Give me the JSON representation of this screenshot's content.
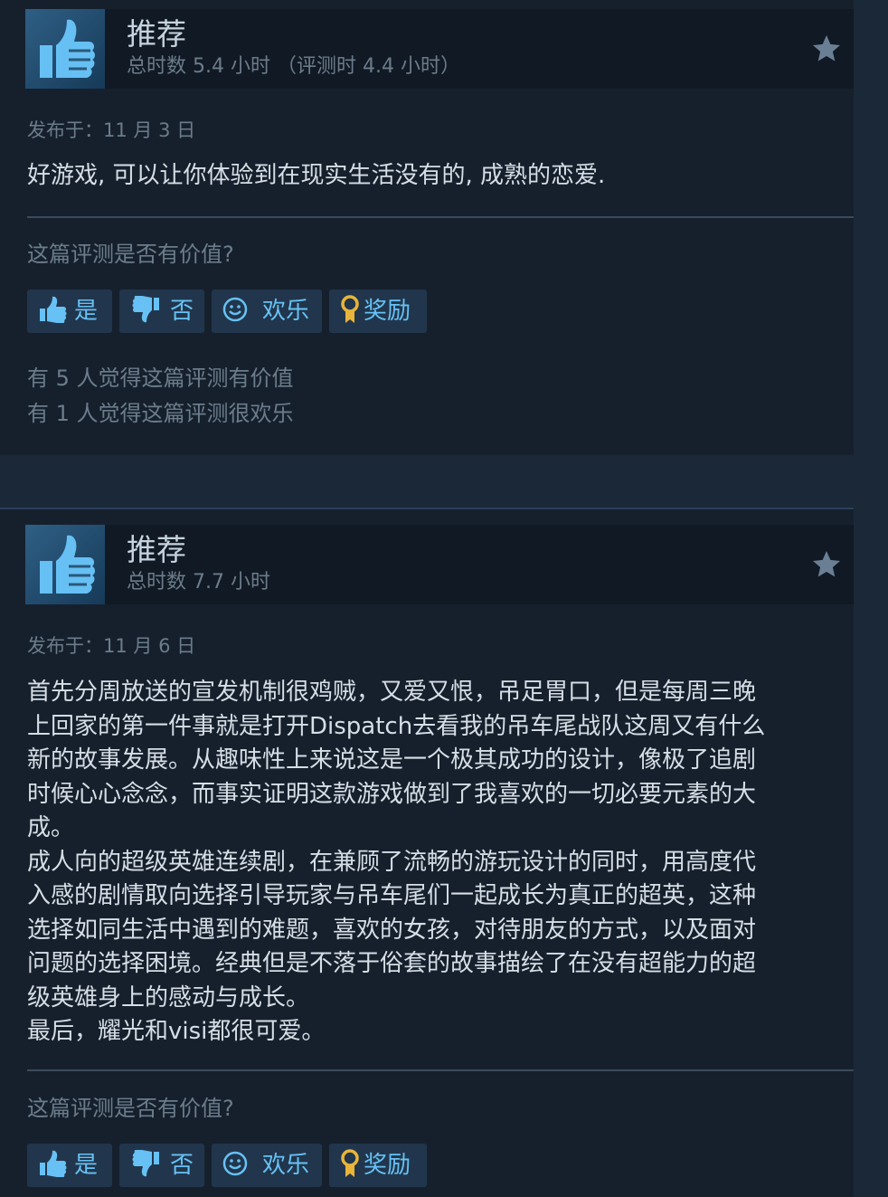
{
  "reviews": [
    {
      "recommendation": "推荐",
      "hours": "总时数 5.4 小时 （评测时 4.4 小时）",
      "posted": "发布于：11 月 3 日",
      "body": [
        "好游戏, 可以让你体验到在现实生活没有的, 成熟的恋爱."
      ],
      "helpful_question": "这篇评测是否有价值?",
      "buttons": {
        "yes": "是",
        "no": "否",
        "funny": "欢乐",
        "award": "奖励"
      },
      "stats": [
        "有 5 人觉得这篇评测有价值",
        "有 1 人觉得这篇评测很欢乐"
      ]
    },
    {
      "recommendation": "推荐",
      "hours": "总时数 7.7 小时",
      "posted": "发布于：11 月 6 日",
      "body": [
        "首先分周放送的宣发机制很鸡贼，又爱又恨，吊足胃口，但是每周三晚",
        "上回家的第一件事就是打开Dispatch去看我的吊车尾战队这周又有什么",
        "新的故事发展。从趣味性上来说这是一个极其成功的设计，像极了追剧",
        "时候心心念念，而事实证明这款游戏做到了我喜欢的一切必要元素的大",
        "成。",
        "成人向的超级英雄连续剧，在兼顾了流畅的游玩设计的同时，用高度代",
        "入感的剧情取向选择引导玩家与吊车尾们一起成长为真正的超英，这种",
        "选择如同生活中遇到的难题，喜欢的女孩，对待朋友的方式，以及面对",
        "问题的选择困境。经典但是不落于俗套的故事描绘了在没有超能力的超",
        "级英雄身上的感动与成长。",
        "最后，耀光和visi都很可爱。"
      ],
      "helpful_question": "这篇评测是否有价值?",
      "buttons": {
        "yes": "是",
        "no": "否",
        "funny": "欢乐",
        "award": "奖励"
      }
    }
  ]
}
